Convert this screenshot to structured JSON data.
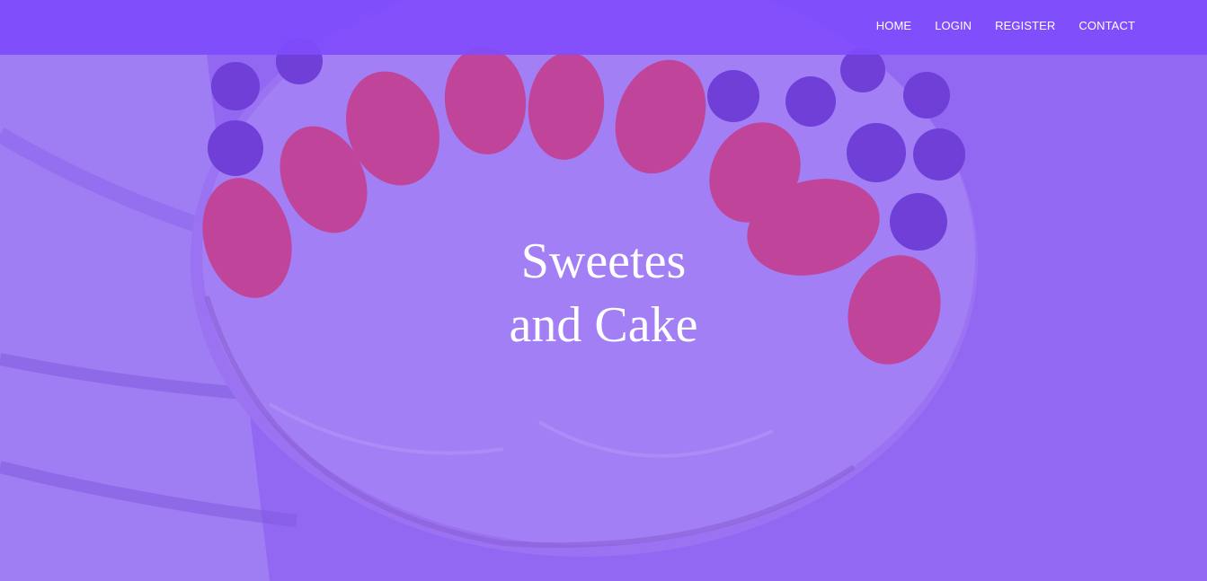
{
  "nav": {
    "items": [
      {
        "label": "HOME"
      },
      {
        "label": "LOGIN"
      },
      {
        "label": "REGISTER"
      },
      {
        "label": "CONTACT"
      }
    ]
  },
  "hero": {
    "title_line1": "Sweetes",
    "title_line2": "and Cake",
    "overlay_color": "#8e62f3",
    "image": "cake-with-strawberries-and-blueberries-photo"
  },
  "colors": {
    "navbar": "#804cfc",
    "overlay": "#9569f2",
    "text": "#ffffff"
  }
}
